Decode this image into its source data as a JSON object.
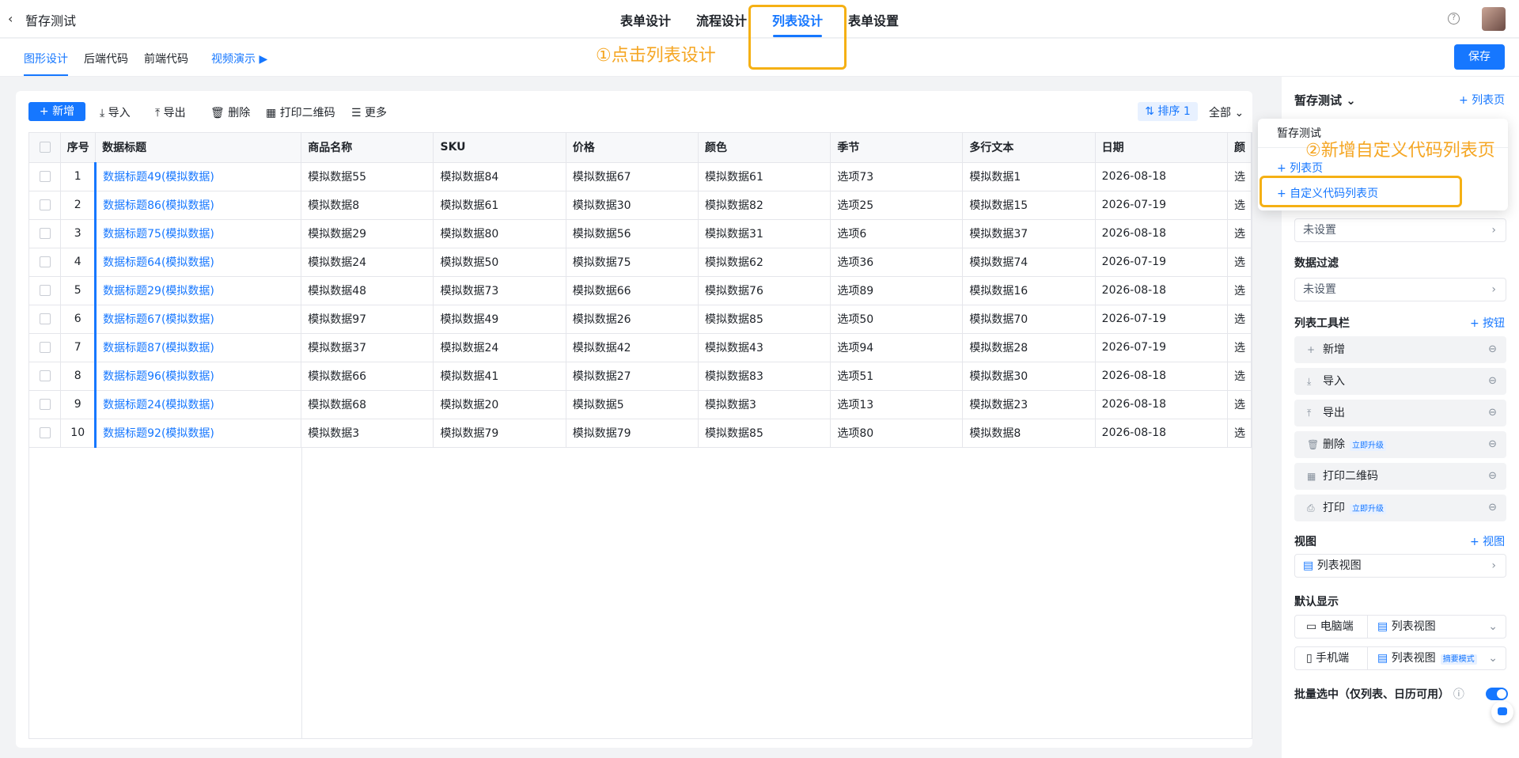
{
  "app": {
    "title": "暂存测试"
  },
  "top_tabs": [
    "表单设计",
    "流程设计",
    "列表设计",
    "表单设置"
  ],
  "sub_tabs": [
    "图形设计",
    "后端代码",
    "前端代码"
  ],
  "video_label": "视频演示",
  "save_label": "保存",
  "annotations": {
    "step1": "①点击列表设计",
    "step2": "②新增自定义代码列表页"
  },
  "toolbar": {
    "new": "新增",
    "import": "导入",
    "export": "导出",
    "delete": "删除",
    "print_qr": "打印二维码",
    "more": "更多",
    "sort": "排序 1",
    "all": "全部"
  },
  "table": {
    "headers": [
      "序号",
      "数据标题",
      "商品名称",
      "SKU",
      "价格",
      "颜色",
      "季节",
      "多行文本",
      "日期",
      "颜"
    ],
    "rows": [
      [
        "1",
        "数据标题49(模拟数据)",
        "模拟数据55",
        "模拟数据84",
        "模拟数据67",
        "模拟数据61",
        "选项73",
        "模拟数据1",
        "2026-08-18",
        "选"
      ],
      [
        "2",
        "数据标题86(模拟数据)",
        "模拟数据8",
        "模拟数据61",
        "模拟数据30",
        "模拟数据82",
        "选项25",
        "模拟数据15",
        "2026-07-19",
        "选"
      ],
      [
        "3",
        "数据标题75(模拟数据)",
        "模拟数据29",
        "模拟数据80",
        "模拟数据56",
        "模拟数据31",
        "选项6",
        "模拟数据37",
        "2026-08-18",
        "选"
      ],
      [
        "4",
        "数据标题64(模拟数据)",
        "模拟数据24",
        "模拟数据50",
        "模拟数据75",
        "模拟数据62",
        "选项36",
        "模拟数据74",
        "2026-07-19",
        "选"
      ],
      [
        "5",
        "数据标题29(模拟数据)",
        "模拟数据48",
        "模拟数据73",
        "模拟数据66",
        "模拟数据76",
        "选项89",
        "模拟数据16",
        "2026-08-18",
        "选"
      ],
      [
        "6",
        "数据标题67(模拟数据)",
        "模拟数据97",
        "模拟数据49",
        "模拟数据26",
        "模拟数据85",
        "选项50",
        "模拟数据70",
        "2026-07-19",
        "选"
      ],
      [
        "7",
        "数据标题87(模拟数据)",
        "模拟数据37",
        "模拟数据24",
        "模拟数据42",
        "模拟数据43",
        "选项94",
        "模拟数据28",
        "2026-07-19",
        "选"
      ],
      [
        "8",
        "数据标题96(模拟数据)",
        "模拟数据66",
        "模拟数据41",
        "模拟数据27",
        "模拟数据83",
        "选项51",
        "模拟数据30",
        "2026-08-18",
        "选"
      ],
      [
        "9",
        "数据标题24(模拟数据)",
        "模拟数据68",
        "模拟数据20",
        "模拟数据5",
        "模拟数据3",
        "选项13",
        "模拟数据23",
        "2026-08-18",
        "选"
      ],
      [
        "10",
        "数据标题92(模拟数据)",
        "模拟数据3",
        "模拟数据79",
        "模拟数据79",
        "模拟数据85",
        "选项80",
        "模拟数据8",
        "2026-08-18",
        "选"
      ]
    ]
  },
  "panel": {
    "title": "暂存测试",
    "add_list_page": "+ 列表页",
    "not_set": "未设置",
    "data_filter": "数据过滤",
    "toolbar_title": "列表工具栏",
    "add_button": "+ 按钮",
    "toolbar_items": [
      "新增",
      "导入",
      "导出",
      "删除",
      "打印二维码",
      "打印"
    ],
    "upgrade_tag": "立即升级",
    "view_title": "视图",
    "add_view": "+ 视图",
    "list_view": "列表视图",
    "default_display": "默认显示",
    "pc": "电脑端",
    "mobile": "手机端",
    "summary_mode": "摘要模式",
    "batch_select": "批量选中（仅列表、日历可用）"
  },
  "dropdown": {
    "header": "暂存测试",
    "list_page": "+ 列表页",
    "custom_code_page": "+ 自定义代码列表页"
  },
  "colors": {
    "primary": "#1677ff",
    "annotation": "#f5b014"
  }
}
